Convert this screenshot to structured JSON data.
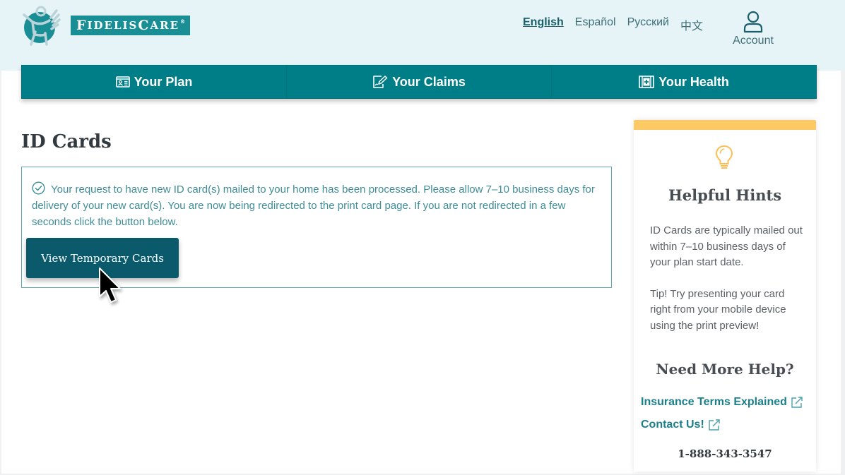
{
  "brand": {
    "name": "FIDELIS CARE",
    "name_first": "F",
    "name_rest1": "IDELIS ",
    "name_second": "C",
    "name_rest2": "ARE",
    "registered": "®"
  },
  "header": {
    "languages": [
      {
        "label": "English",
        "active": true
      },
      {
        "label": "Español",
        "active": false
      },
      {
        "label": "Русский",
        "active": false
      },
      {
        "label": "中文",
        "active": false
      }
    ],
    "account_label": "Account"
  },
  "nav": {
    "items": [
      {
        "label": "Your Plan",
        "icon": "id-card-icon"
      },
      {
        "label": "Your Claims",
        "icon": "claims-edit-icon"
      },
      {
        "label": "Your Health",
        "icon": "medical-plus-icon"
      }
    ]
  },
  "main": {
    "title": "ID Cards",
    "alert": {
      "icon": "check-circle-icon",
      "message": "Your request to have new ID card(s) mailed to your home has been processed. Please allow 7–10 business days for delivery of your new card(s). You are now being redirected to the print card page. If you are not redirected in a few seconds click the button below.",
      "button_label": "View Temporary Cards"
    }
  },
  "sidebar": {
    "icon": "lightbulb-icon",
    "hints_title": "Helpful Hints",
    "hints": [
      "ID Cards are typically mailed out within 7–10 business days of your plan start date.",
      "Tip! Try presenting your card right from your mobile device using the print preview!"
    ],
    "help_title": "Need More Help?",
    "links": [
      {
        "label": "Insurance Terms Explained",
        "icon": "external-link-icon"
      },
      {
        "label": "Contact Us!",
        "icon": "external-link-icon"
      }
    ],
    "phone": "1-888-343-3547"
  },
  "colors": {
    "header_bg": "#e6f4f7",
    "nav_bg": "#007e87",
    "brand_teal": "#1a8e95",
    "button_bg": "#0b5a6c",
    "alert_text": "#3e8c97",
    "sidebar_accent": "#fdc965",
    "link": "#1c7f8a"
  }
}
